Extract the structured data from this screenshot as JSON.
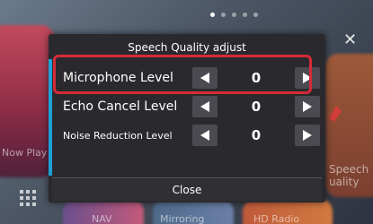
{
  "background": {
    "now_playing_label": "Now Play",
    "side_label_line1": "Speech",
    "side_label_line2": "uality",
    "bottom_labels": [
      "NAV",
      "Mirroring",
      "HD Radio"
    ],
    "page_count": 5,
    "active_page": 1
  },
  "dialog": {
    "title": "Speech Quality adjust",
    "rows": [
      {
        "label": "Microphone Level",
        "value": "0"
      },
      {
        "label": "Echo Cancel Level",
        "value": "0"
      },
      {
        "label": "Noise Reduction Level",
        "value": "0"
      }
    ],
    "close_label": "Close"
  },
  "colors": {
    "accent": "#1da1d8",
    "highlight": "#d62b36",
    "dialog_bg": "#2a2a2e",
    "button_bg": "#4a4a50"
  },
  "icons": {
    "decrease": "left-triangle-icon",
    "increase": "right-triangle-icon",
    "close_x": "close-icon",
    "apps": "grid-icon"
  }
}
